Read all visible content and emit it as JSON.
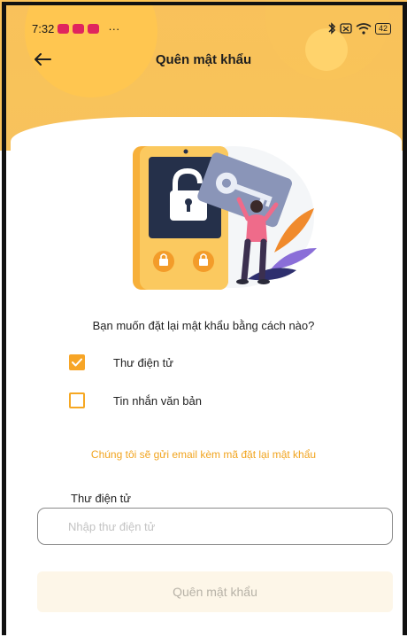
{
  "status_bar": {
    "time": "7:32",
    "more": "···",
    "battery": "42",
    "icons": [
      "notification-icon",
      "notification-icon",
      "notification-icon",
      "bluetooth-icon",
      "sim-icon",
      "wifi-icon",
      "battery-icon"
    ]
  },
  "header": {
    "title": "Quên mật khẩu",
    "back_icon": "arrow-left-icon"
  },
  "illustration": {
    "name": "unlock-padlock-illustration"
  },
  "form": {
    "question": "Bạn muốn đặt lại mật khẩu bằng cách nào?",
    "options": [
      {
        "label": "Thư điện tử",
        "checked": true
      },
      {
        "label": "Tin nhắn văn bản",
        "checked": false
      }
    ],
    "info": "Chúng tôi sẽ gửi email kèm mã đặt lại mật khẩu",
    "email_label": "Thư điện tử",
    "email_placeholder": "Nhập thư điện tử",
    "email_value": "",
    "submit_label": "Quên mật khẩu"
  },
  "colors": {
    "accent": "#f7a526",
    "header_bg": "#f8c35a",
    "info_text": "#f1a41f",
    "button_bg": "#fdf6e8"
  }
}
